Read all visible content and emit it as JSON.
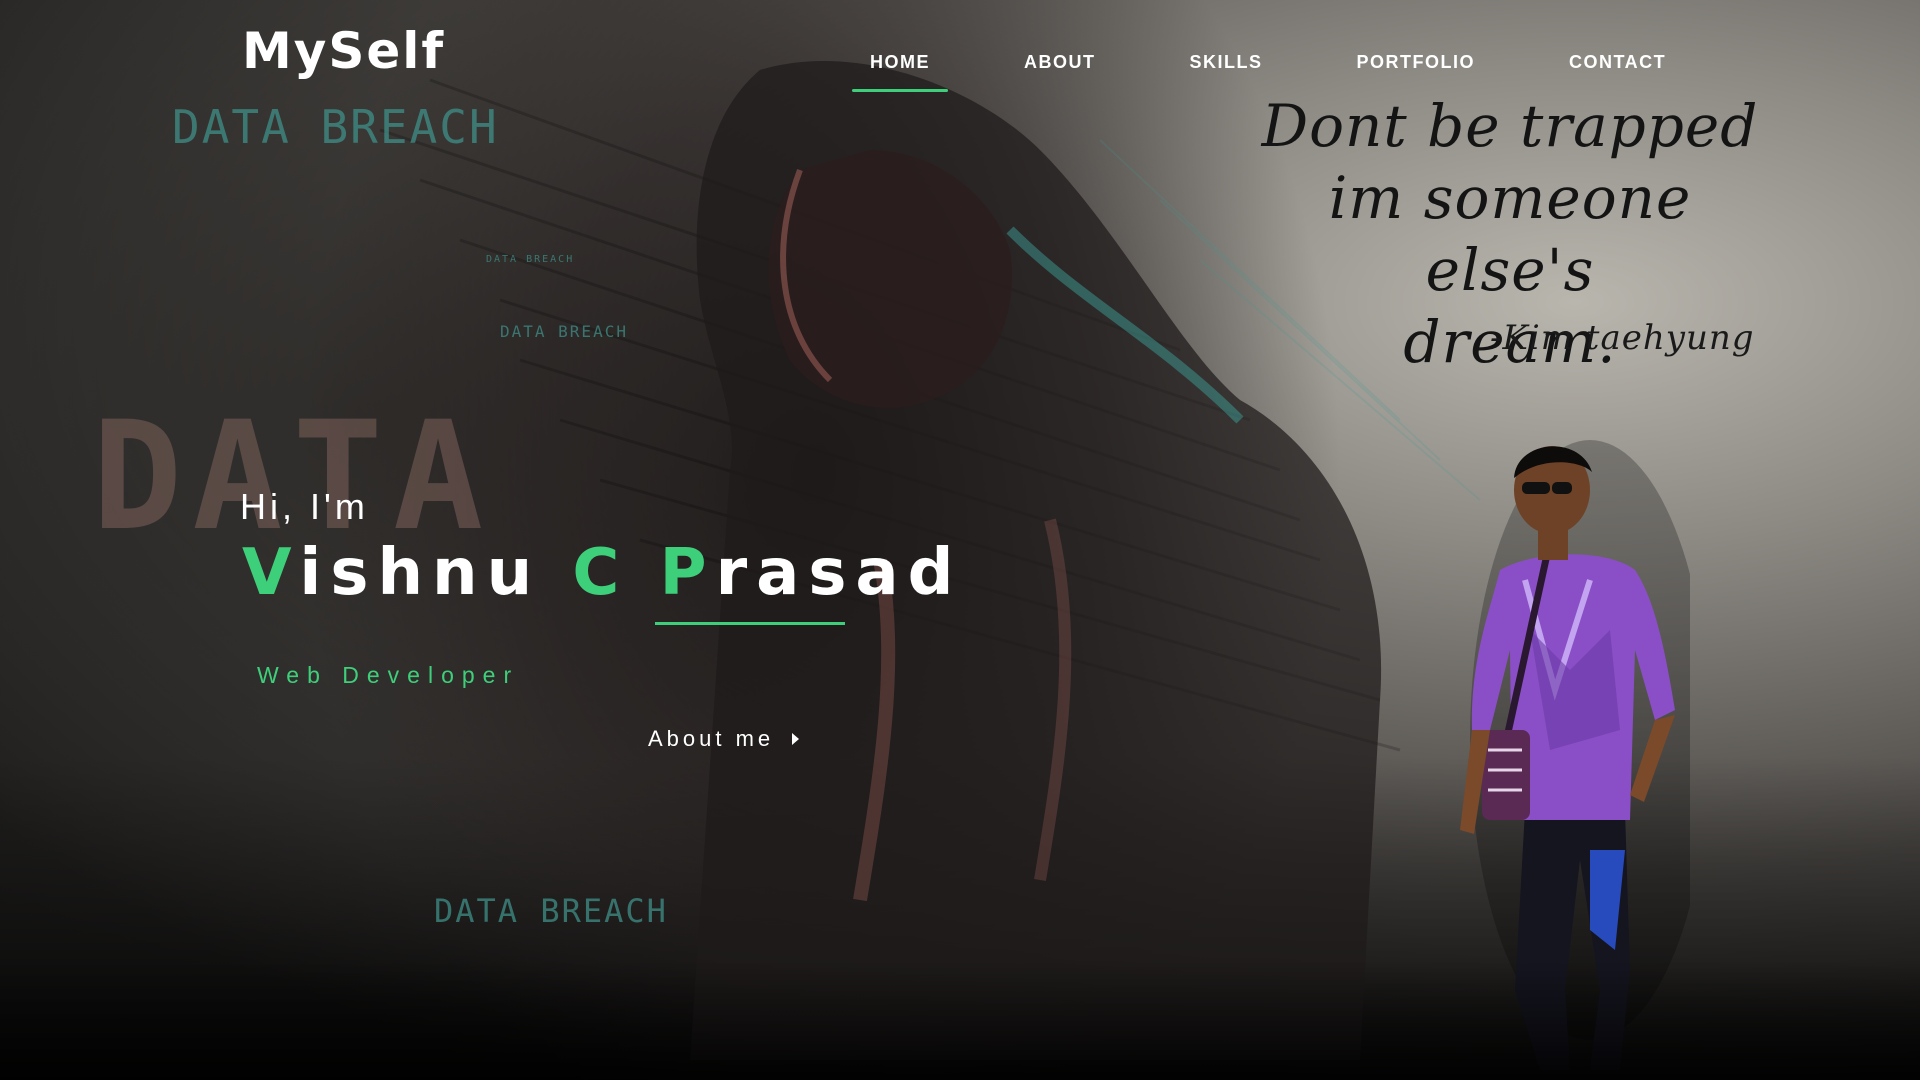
{
  "header": {
    "logo": "MySelf",
    "nav": [
      {
        "label": "HOME",
        "active": true
      },
      {
        "label": "ABOUT",
        "active": false
      },
      {
        "label": "SKILLS",
        "active": false
      },
      {
        "label": "PORTFOLIO",
        "active": false
      },
      {
        "label": "CONTACT",
        "active": false
      }
    ]
  },
  "background": {
    "glitch_texts": [
      "DATA BREACH",
      "DATA BREACH",
      "DATA BREACH",
      "DATA BREACH",
      "DATA"
    ]
  },
  "quote": {
    "lines": [
      "Dont be trapped",
      "im someone else's",
      "dream."
    ],
    "author": "-Kim taehyung"
  },
  "hero": {
    "greeting": "Hi, I'm",
    "name_parts": [
      {
        "initial": "V",
        "rest": "ishnu"
      },
      {
        "initial": "C",
        "rest": ""
      },
      {
        "initial": "P",
        "rest": "rasad"
      }
    ],
    "role": "Web Developer",
    "cta_label": "About me"
  },
  "colors": {
    "accent": "#3ecf7a",
    "text": "#ffffff",
    "quote_ink": "#141414"
  }
}
